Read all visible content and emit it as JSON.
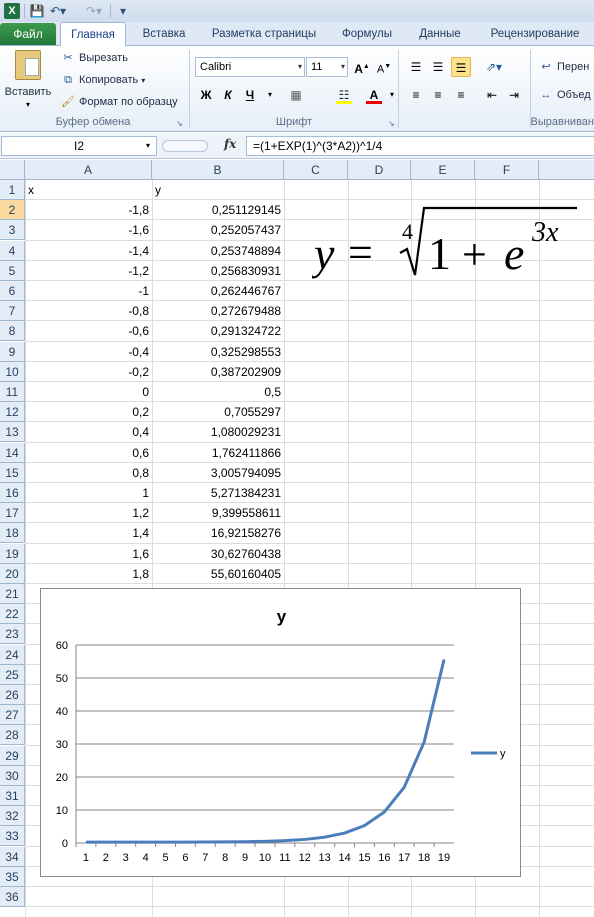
{
  "app": {
    "icon_letter": "X"
  },
  "tabs": [
    "Файл",
    "Главная",
    "Вставка",
    "Разметка страницы",
    "Формулы",
    "Данные",
    "Рецензирование"
  ],
  "ribbon": {
    "clipboard": {
      "paste": "Вставить",
      "cut": "Вырезать",
      "copy": "Копировать",
      "format_painter": "Формат по образцу",
      "label": "Буфер обмена"
    },
    "font": {
      "name": "Calibri",
      "size": "11",
      "bold": "Ж",
      "italic": "К",
      "underline": "Ч",
      "label": "Шрифт"
    },
    "alignment": {
      "wrap": "Перен",
      "merge": "Объед",
      "label": "Выравниван"
    }
  },
  "formula_bar": {
    "name_box": "I2",
    "fx": "fx",
    "formula": "=(1+EXP(1)^(3*A2))^1/4"
  },
  "columns": [
    "A",
    "B",
    "C",
    "D",
    "E",
    "F"
  ],
  "rows": [
    "1",
    "2",
    "3",
    "4",
    "5",
    "6",
    "7",
    "8",
    "9",
    "10",
    "11",
    "12",
    "13",
    "14",
    "15",
    "16",
    "17",
    "18",
    "19",
    "20",
    "21",
    "22",
    "23",
    "24",
    "25",
    "26",
    "27",
    "28",
    "29",
    "30",
    "31",
    "32",
    "33",
    "34",
    "35",
    "36"
  ],
  "sheet": {
    "header": [
      "x",
      "y"
    ],
    "data": [
      [
        "-1,8",
        "0,251129145"
      ],
      [
        "-1,6",
        "0,252057437"
      ],
      [
        "-1,4",
        "0,253748894"
      ],
      [
        "-1,2",
        "0,256830931"
      ],
      [
        "-1",
        "0,262446767"
      ],
      [
        "-0,8",
        "0,272679488"
      ],
      [
        "-0,6",
        "0,291324722"
      ],
      [
        "-0,4",
        "0,325298553"
      ],
      [
        "-0,2",
        "0,387202909"
      ],
      [
        "0",
        "0,5"
      ],
      [
        "0,2",
        "0,7055297"
      ],
      [
        "0,4",
        "1,080029231"
      ],
      [
        "0,6",
        "1,762411866"
      ],
      [
        "0,8",
        "3,005794095"
      ],
      [
        "1",
        "5,271384231"
      ],
      [
        "1,2",
        "9,399558611"
      ],
      [
        "1,4",
        "16,92158276"
      ],
      [
        "1,6",
        "30,62760438"
      ],
      [
        "1,8",
        "55,60160405"
      ]
    ]
  },
  "equation": {
    "lhs": "y",
    "eq": "=",
    "root_index": "4",
    "one": "1",
    "plus": "+",
    "base": "e",
    "exponent": "3x"
  },
  "chart_data": {
    "type": "line",
    "title": "y",
    "categories": [
      1,
      2,
      3,
      4,
      5,
      6,
      7,
      8,
      9,
      10,
      11,
      12,
      13,
      14,
      15,
      16,
      17,
      18,
      19
    ],
    "series": [
      {
        "name": "y",
        "color": "#4a7ebb",
        "values": [
          0.251129145,
          0.252057437,
          0.253748894,
          0.256830931,
          0.262446767,
          0.272679488,
          0.291324722,
          0.325298553,
          0.387202909,
          0.5,
          0.7055297,
          1.080029231,
          1.762411866,
          3.005794095,
          5.271384231,
          9.399558611,
          16.92158276,
          30.62760438,
          55.60160405
        ]
      }
    ],
    "yticks": [
      0,
      10,
      20,
      30,
      40,
      50,
      60
    ],
    "ylim": [
      0,
      60
    ],
    "grid": true,
    "legend": "right"
  }
}
